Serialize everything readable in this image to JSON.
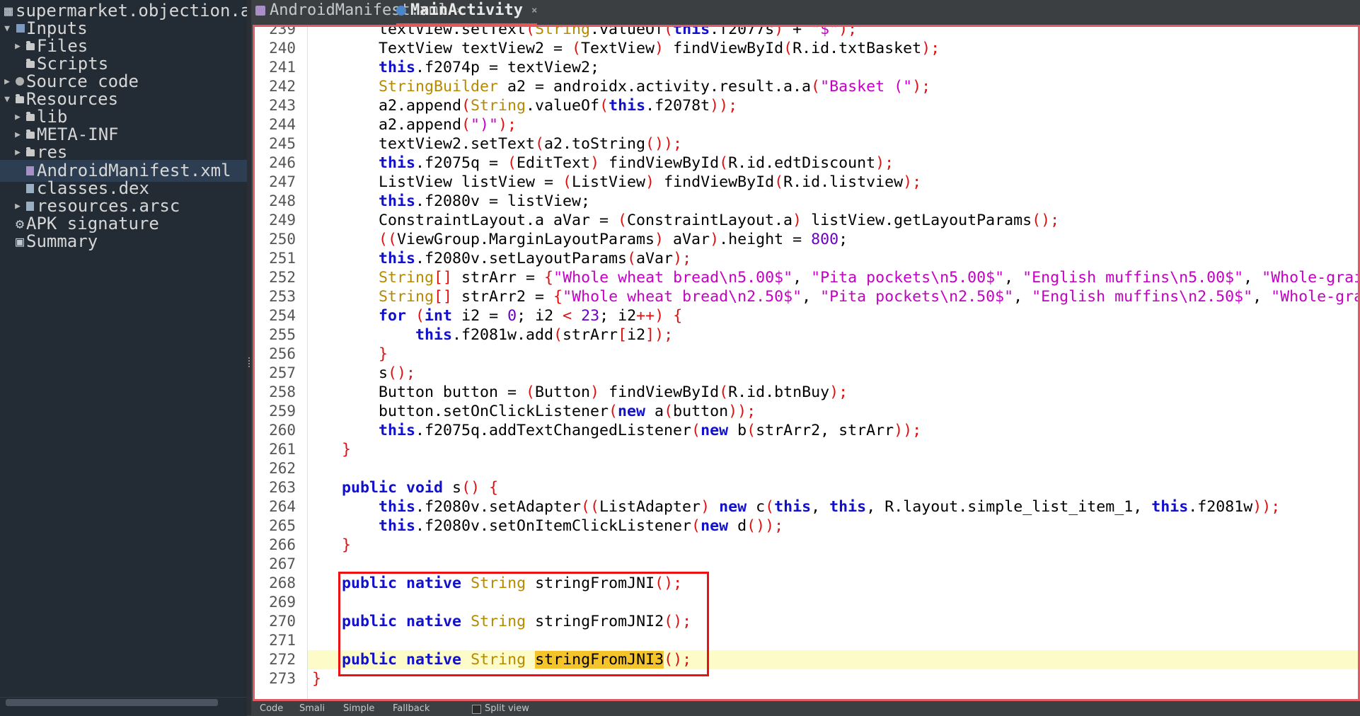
{
  "sidebar": {
    "project_title": "supermarket.objection.a",
    "items": [
      {
        "label": "Inputs",
        "expanded": true
      },
      {
        "label": "Files",
        "expanded": false
      },
      {
        "label": "Scripts"
      },
      {
        "label": "Source code",
        "expanded": false
      },
      {
        "label": "Resources",
        "expanded": true
      },
      {
        "label": "lib",
        "expanded": false
      },
      {
        "label": "META-INF",
        "expanded": false
      },
      {
        "label": "res",
        "expanded": false
      },
      {
        "label": "AndroidManifest.xml",
        "selected": true
      },
      {
        "label": "classes.dex"
      },
      {
        "label": "resources.arsc",
        "expanded": false
      },
      {
        "label": "APK signature"
      },
      {
        "label": "Summary"
      }
    ]
  },
  "tabs": [
    {
      "label": "AndroidManifest.xml",
      "close": "×"
    },
    {
      "label": "MainActivity",
      "close": "×",
      "active": true
    }
  ],
  "editor": {
    "line_numbers": [
      "239",
      "240",
      "241",
      "242",
      "243",
      "244",
      "245",
      "246",
      "247",
      "248",
      "249",
      "250",
      "251",
      "252",
      "253",
      "254",
      "255",
      "256",
      "257",
      "258",
      "259",
      "260",
      "261",
      "262",
      "263",
      "264",
      "265",
      "266",
      "267",
      "268",
      "269",
      "270",
      "271",
      "272",
      "273"
    ],
    "highlighted_identifier": "stringFromJNI3",
    "current_line": "272"
  },
  "bottom_tabs": [
    "Code",
    "Smali",
    "Simple",
    "Fallback"
  ],
  "split_view_label": "Split view",
  "colors": {
    "keyword": "#1111cc",
    "type": "#b58a00",
    "string": "#c400c4",
    "number": "#6a00c4",
    "bracket": "#dd1111",
    "annotation_border": "#ee1111",
    "editor_frame": "#e05a63",
    "selection_highlight": "#f5c42a",
    "current_line_bg": "#fdfbc8"
  }
}
